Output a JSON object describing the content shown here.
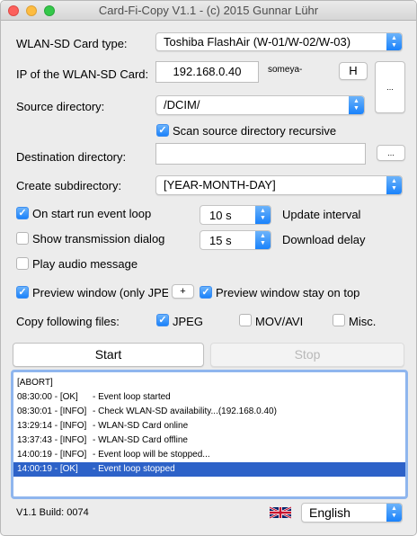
{
  "window": {
    "title": "Card-Fi-Copy V1.1 - (c) 2015 Gunnar Lühr"
  },
  "card_type": {
    "label": "WLAN-SD Card type:",
    "value": "Toshiba FlashAir (W-01/W-02/W-03)"
  },
  "ip": {
    "label": "IP of the WLAN-SD Card:",
    "value": "192.168.0.40",
    "host": "someya-",
    "h_button": "H",
    "side_button": "..."
  },
  "source": {
    "label": "Source directory:",
    "value": "/DCIM/",
    "recursive_label": "Scan source directory recursive",
    "recursive_checked": true
  },
  "destination": {
    "label": "Destination directory:",
    "value": "",
    "browse_button": "..."
  },
  "subdir": {
    "label": "Create subdirectory:",
    "value": "[YEAR-MONTH-DAY]"
  },
  "options": {
    "event_loop": {
      "label": "On start run event loop",
      "checked": true
    },
    "transmission": {
      "label": "Show transmission dialog",
      "checked": false
    },
    "audio": {
      "label": "Play audio message",
      "checked": false
    },
    "preview": {
      "label": "Preview window (only JPEG",
      "checked": true,
      "plus_button": "+"
    },
    "preview_top": {
      "label": "Preview window stay on top",
      "checked": true
    },
    "update_interval": {
      "value": "10 s",
      "label": "Update interval"
    },
    "download_delay": {
      "value": "15 s",
      "label": "Download delay"
    }
  },
  "copy_files": {
    "label": "Copy following files:",
    "jpeg": {
      "label": "JPEG",
      "checked": true
    },
    "mov": {
      "label": "MOV/AVI",
      "checked": false
    },
    "misc": {
      "label": "Misc.",
      "checked": false
    }
  },
  "buttons": {
    "start": "Start",
    "stop": "Stop"
  },
  "log": [
    {
      "time": "[ABORT]",
      "msg": ""
    },
    {
      "time": "08:30:00 - [OK]",
      "msg": "- Event loop started"
    },
    {
      "time": "08:30:01 - [INFO]",
      "msg": "- Check WLAN-SD availability...(192.168.0.40)"
    },
    {
      "time": "13:29:14 - [INFO]",
      "msg": "- WLAN-SD Card online"
    },
    {
      "time": "13:37:43 - [INFO]",
      "msg": "- WLAN-SD Card offline"
    },
    {
      "time": "14:00:19 - [INFO]",
      "msg": "- Event loop will be stopped..."
    },
    {
      "time": "14:00:19 - [OK]",
      "msg": "- Event loop stopped"
    }
  ],
  "footer": {
    "build": "V1.1 Build: 0074",
    "language": "English",
    "flag_icon": "uk-flag-icon"
  },
  "colors": {
    "accent": "#1a82fb",
    "selection": "#2d62c8"
  }
}
